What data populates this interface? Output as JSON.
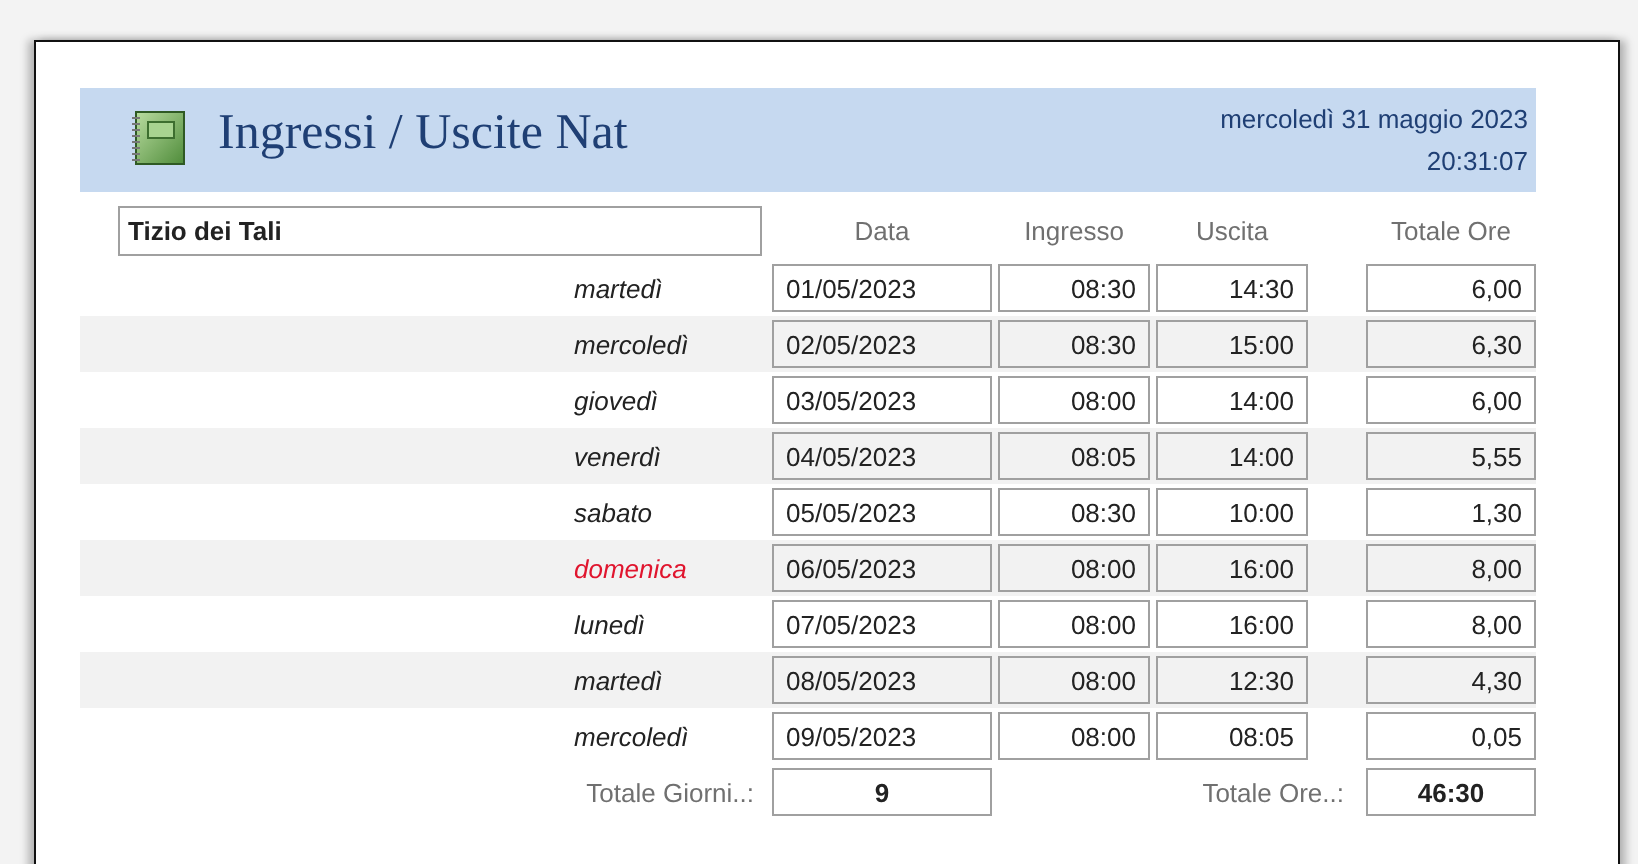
{
  "header": {
    "title": "Ingressi / Uscite Nat",
    "date": "mercoledì 31 maggio 2023",
    "time": "20:31:07"
  },
  "name_field": {
    "value": "Tizio dei Tali"
  },
  "columns": [
    "Data",
    "Ingresso",
    "Uscita",
    "Totale Ore"
  ],
  "rows": [
    {
      "day": "martedì",
      "holiday": false,
      "date": "01/05/2023",
      "in": "08:30",
      "out": "14:30",
      "total": "6,00"
    },
    {
      "day": "mercoledì",
      "holiday": false,
      "date": "02/05/2023",
      "in": "08:30",
      "out": "15:00",
      "total": "6,30"
    },
    {
      "day": "giovedì",
      "holiday": false,
      "date": "03/05/2023",
      "in": "08:00",
      "out": "14:00",
      "total": "6,00"
    },
    {
      "day": "venerdì",
      "holiday": false,
      "date": "04/05/2023",
      "in": "08:05",
      "out": "14:00",
      "total": "5,55"
    },
    {
      "day": "sabato",
      "holiday": false,
      "date": "05/05/2023",
      "in": "08:30",
      "out": "10:00",
      "total": "1,30"
    },
    {
      "day": "domenica",
      "holiday": true,
      "date": "06/05/2023",
      "in": "08:00",
      "out": "16:00",
      "total": "8,00"
    },
    {
      "day": "lunedì",
      "holiday": false,
      "date": "07/05/2023",
      "in": "08:00",
      "out": "16:00",
      "total": "8,00"
    },
    {
      "day": "martedì",
      "holiday": false,
      "date": "08/05/2023",
      "in": "08:00",
      "out": "12:30",
      "total": "4,30"
    },
    {
      "day": "mercoledì",
      "holiday": false,
      "date": "09/05/2023",
      "in": "08:00",
      "out": "08:05",
      "total": "0,05"
    }
  ],
  "footer": {
    "days_label": "Totale Giorni..:",
    "days_value": "9",
    "hours_label": "Totale Ore..:",
    "hours_value": "46:30"
  }
}
